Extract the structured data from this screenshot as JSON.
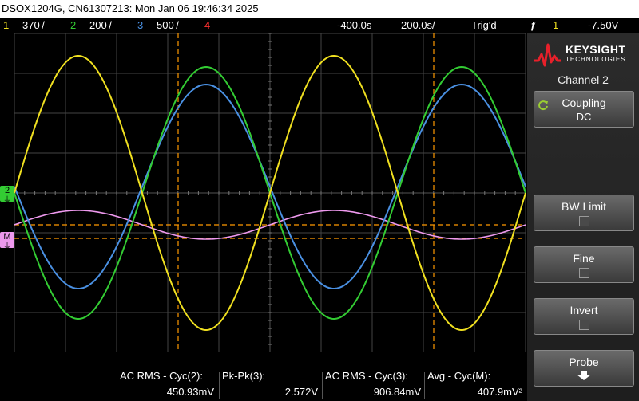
{
  "title": "DSOX1204G, CN61307213: Mon Jan 06 19:46:34 2025",
  "status": {
    "ch1_num": "1",
    "ch1_scale": "370 /",
    "ch2_num": "2",
    "ch2_scale": "200 /",
    "ch3_num": "3",
    "ch3_scale": "500 /",
    "ch4_num": "4",
    "delay": "-400.0s",
    "timebase": "200.0s/",
    "trig_state": "Trig'd",
    "trig_src": "1",
    "trig_level": "-7.50V"
  },
  "colors": {
    "ch1": "#f0e020",
    "ch2": "#33cc33",
    "ch3": "#4a90e2",
    "ch4": "#ff3030",
    "math": "#ee99ee",
    "grid": "#444444",
    "cursor": "#ff9900"
  },
  "markers": {
    "ch2": "2",
    "math": "M"
  },
  "panel": {
    "brand": "KEYSIGHT",
    "brand_sub": "TECHNOLOGIES",
    "title": "Channel 2",
    "coupling_label": "Coupling",
    "coupling_value": "DC",
    "bw_limit": "BW Limit",
    "fine": "Fine",
    "invert": "Invert",
    "probe": "Probe"
  },
  "measurements": [
    {
      "label": "AC RMS - Cyc(2):",
      "value": "450.93mV"
    },
    {
      "label": "Pk-Pk(3):",
      "value": "2.572V"
    },
    {
      "label": "AC RMS - Cyc(3):",
      "value": "906.84mV"
    },
    {
      "label": "Avg - Cyc(M):",
      "value": "407.9mV²"
    }
  ]
}
